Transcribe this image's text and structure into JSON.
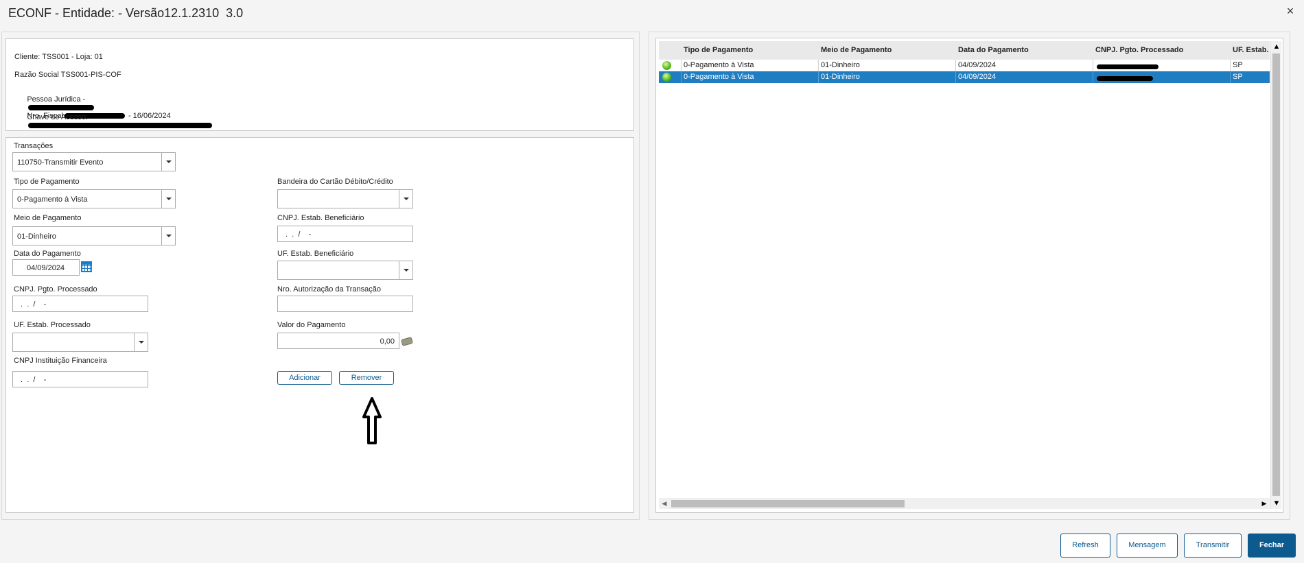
{
  "window": {
    "title": "ECONF - Entidade: - Versão12.1.2310  3.0",
    "close_glyph": "×"
  },
  "info": {
    "cliente": "Cliente: TSS001 - Loja: 01",
    "razao_social": "Razão Social TSS001-PIS-COF",
    "pessoa_juridica_prefix": "Pessoa Jurídica -",
    "nro_fiscal_prefix": "Nro. Fiscal",
    "nro_fiscal_suffix": " - 16/06/2024",
    "chave_prefix": "Chave de Acesso:"
  },
  "form": {
    "transacoes": {
      "label": "Transações",
      "value": "110750-Transmitir Evento"
    },
    "tipo_pagamento": {
      "label": "Tipo de Pagamento",
      "value": "0-Pagamento à Vista"
    },
    "meio_pagamento": {
      "label": "Meio de Pagamento",
      "value": "01-Dinheiro"
    },
    "data_pagamento": {
      "label": "Data do Pagamento",
      "value": "04/09/2024"
    },
    "cnpj_processado": {
      "label": "CNPJ. Pgto. Processado",
      "value": " .  .  /    -"
    },
    "uf_processado": {
      "label": "UF. Estab. Processado",
      "value": ""
    },
    "cnpj_instituicao": {
      "label": "CNPJ Instituição Financeira",
      "value": " .  .  /    -"
    },
    "bandeira": {
      "label": "Bandeira do Cartão Débito/Crédito",
      "value": ""
    },
    "cnpj_beneficiario": {
      "label": "CNPJ. Estab. Beneficiário",
      "value": " .  .  /    -"
    },
    "uf_beneficiario": {
      "label": "UF. Estab. Beneficiário",
      "value": ""
    },
    "nro_autorizacao": {
      "label": "Nro. Autorização da Transação",
      "value": ""
    },
    "valor_pagamento": {
      "label": "Valor do Pagamento",
      "value": "0,00"
    },
    "adicionar_label": "Adicionar",
    "remover_label": "Remover"
  },
  "grid": {
    "columns": [
      "Tipo de Pagamento",
      "Meio de Pagamento",
      "Data do Pagamento",
      "CNPJ. Pgto. Processado",
      "UF. Estab."
    ],
    "rows": [
      {
        "tipo": "0-Pagamento à Vista",
        "meio": "01-Dinheiro",
        "data": "04/09/2024",
        "uf": "SP",
        "selected": false
      },
      {
        "tipo": "0-Pagamento à Vista",
        "meio": "01-Dinheiro",
        "data": "04/09/2024",
        "uf": "SP",
        "selected": true
      }
    ],
    "scroll_up_glyph": "▲",
    "scroll_down_glyph": "▼",
    "scroll_left_glyph": "◀",
    "scroll_right_glyph": "▶"
  },
  "footer": {
    "refresh": "Refresh",
    "mensagem": "Mensagem",
    "transmitir": "Transmitir",
    "fechar": "Fechar"
  },
  "colors": {
    "accent": "#0d5a8f",
    "selected_row": "#1f7ec2",
    "status_ok": "#55b41e"
  },
  "icons": {
    "status": "green-status-icon",
    "calendar": "calendar-icon",
    "money": "money-icon",
    "annotation": "up-arrow-annotation-icon"
  }
}
